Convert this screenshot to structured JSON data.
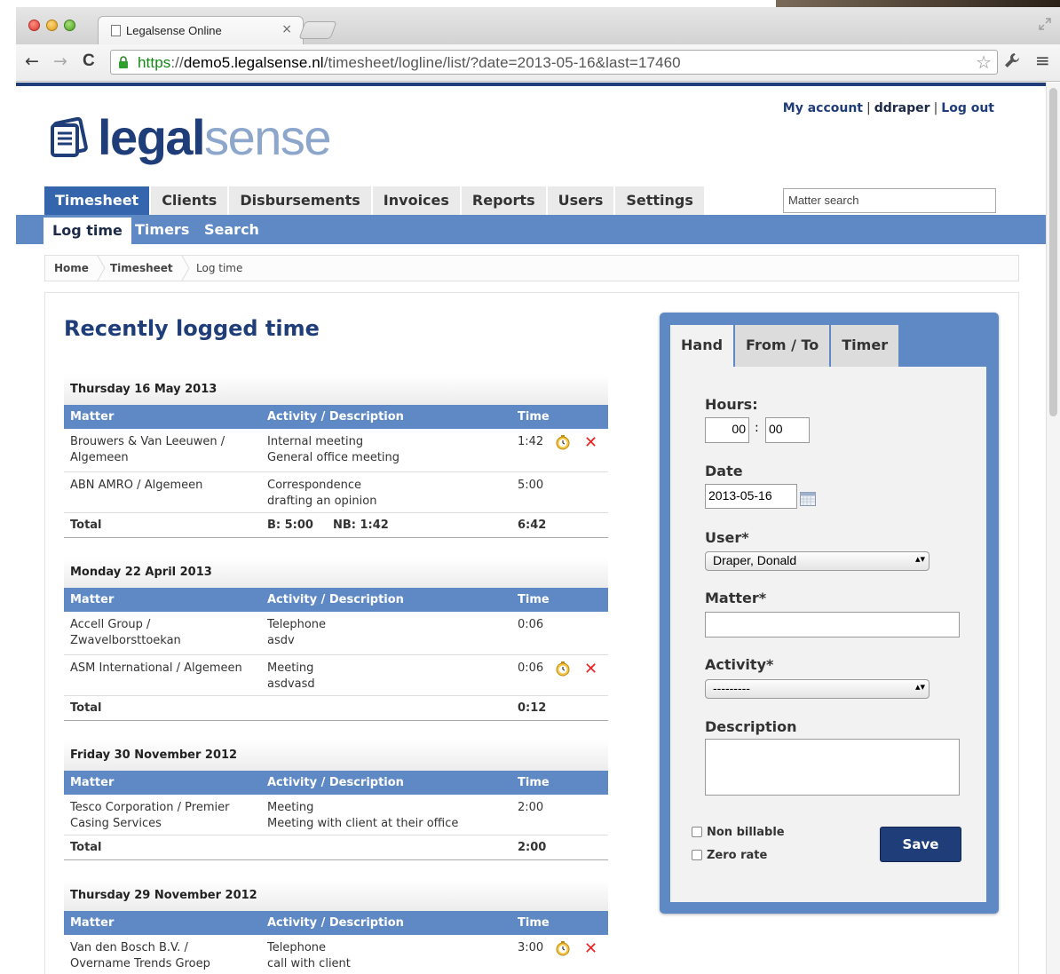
{
  "browser": {
    "tab_title": "Legalsense Online",
    "tab_close": "×",
    "url_scheme": "https",
    "url_sep": "://",
    "url_host": "demo5.legalsense.nl",
    "url_path": "/timesheet/logline/list/?date=2013-05-16&last=17460",
    "back_glyph": "←",
    "forward_glyph": "→",
    "reload_glyph": "C",
    "star_glyph": "☆",
    "wrench_glyph": "🔧",
    "menu_glyph": "≡"
  },
  "logo": {
    "part1": "legal",
    "part2": "sense"
  },
  "userbar": {
    "my_account": "My account",
    "username": "ddraper",
    "logout": "Log out",
    "sep": "|"
  },
  "mainnav": [
    "Timesheet",
    "Clients",
    "Disbursements",
    "Invoices",
    "Reports",
    "Users",
    "Settings"
  ],
  "matter_search_placeholder": "Matter search",
  "subnav": [
    "Log time",
    "Timers",
    "Search"
  ],
  "breadcrumb": [
    "Home",
    "Timesheet",
    "Log time"
  ],
  "title": "Recently logged time",
  "columns": {
    "matter": "Matter",
    "activity": "Activity / Description",
    "time": "Time"
  },
  "total_label": "Total",
  "groups": [
    {
      "date": "Thursday 16 May 2013",
      "rows": [
        {
          "matter": [
            "Brouwers & Van Leeuwen /",
            "Algemeen"
          ],
          "activity": [
            "Internal meeting",
            "General office meeting"
          ],
          "time": "1:42",
          "actions": true
        },
        {
          "matter": [
            "ABN AMRO / Algemeen"
          ],
          "activity": [
            "Correspondence",
            "drafting an opinion"
          ],
          "time": "5:00",
          "actions": false
        }
      ],
      "total_b": "B: 5:00",
      "total_nb": "NB: 1:42",
      "total": "6:42"
    },
    {
      "date": "Monday 22 April 2013",
      "rows": [
        {
          "matter": [
            "Accell Group /",
            "Zwavelborsttoekan"
          ],
          "activity": [
            "Telephone",
            "asdv"
          ],
          "time": "0:06",
          "actions": false
        },
        {
          "matter": [
            "ASM International / Algemeen"
          ],
          "activity": [
            "Meeting",
            "asdvasd"
          ],
          "time": "0:06",
          "actions": true
        }
      ],
      "total_b": "",
      "total_nb": "",
      "total": "0:12"
    },
    {
      "date": "Friday 30 November 2012",
      "rows": [
        {
          "matter": [
            "Tesco Corporation / Premier",
            "Casing Services"
          ],
          "activity": [
            "Meeting",
            "Meeting with client at their office"
          ],
          "time": "2:00",
          "actions": false
        }
      ],
      "total_b": "",
      "total_nb": "",
      "total": "2:00"
    },
    {
      "date": "Thursday 29 November 2012",
      "rows": [
        {
          "matter": [
            "Van den Bosch B.V. /",
            "Overname Trends Groep"
          ],
          "activity": [
            "Telephone",
            "call with client"
          ],
          "time": "3:00",
          "actions": true
        }
      ],
      "total_b": "",
      "total_nb": "",
      "total": ""
    }
  ],
  "delete_glyph": "✕",
  "form": {
    "tabs": [
      "Hand",
      "From / To",
      "Timer"
    ],
    "hours_label": "Hours:",
    "hours_h": "00",
    "hours_sep": ":",
    "hours_m": "00",
    "date_label": "Date",
    "date_value": "2013-05-16",
    "user_label": "User*",
    "user_value": "Draper, Donald",
    "matter_label": "Matter*",
    "activity_label": "Activity*",
    "activity_value": "---------",
    "description_label": "Description",
    "non_billable": "Non billable",
    "zero_rate": "Zero rate",
    "save": "Save",
    "select_arrows": "▴▾"
  },
  "colors": {
    "brand_dark": "#1f3d78",
    "brand_mid": "#5f89c4",
    "logo_light": "#8da6cc",
    "delete": "#e22222"
  }
}
